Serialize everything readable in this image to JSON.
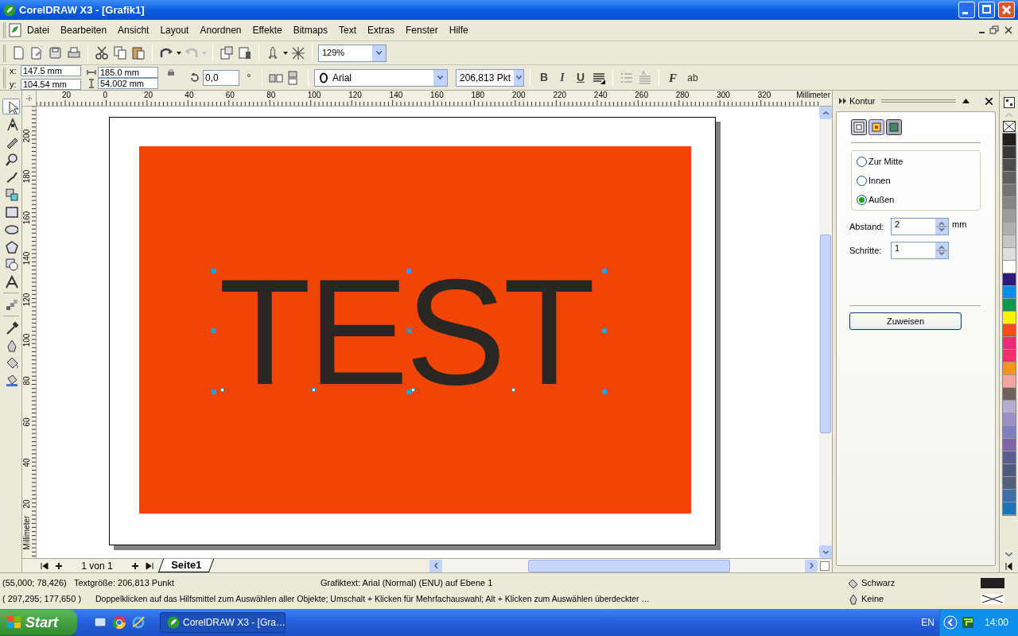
{
  "window": {
    "title": "CorelDRAW X3 - [Grafik1]"
  },
  "menu": [
    "Datei",
    "Bearbeiten",
    "Ansicht",
    "Layout",
    "Anordnen",
    "Effekte",
    "Bitmaps",
    "Text",
    "Extras",
    "Fenster",
    "Hilfe"
  ],
  "toolbar": {
    "zoom": "129%"
  },
  "property_bar": {
    "x_label": "x:",
    "x": "147.5 mm",
    "y_label": "y:",
    "y": "104.54 mm",
    "width": "185.0 mm",
    "height": "54.002 mm",
    "rotation": "0,0",
    "rotation_unit": "°",
    "font": "Arial",
    "font_size": "206,813 Pkt",
    "style_buttons": [
      "B",
      "I",
      "U"
    ],
    "text_buttons": [
      "F",
      "ab"
    ]
  },
  "h_ruler": {
    "labels": [
      "20",
      "0",
      "20",
      "40",
      "60",
      "80",
      "100",
      "120",
      "140",
      "160",
      "180",
      "200",
      "220",
      "240",
      "260",
      "280",
      "300",
      "320"
    ],
    "unit": "Millimeter"
  },
  "v_ruler": {
    "labels": [
      "200",
      "180",
      "160",
      "140",
      "120",
      "100",
      "80",
      "60",
      "40",
      "20"
    ],
    "unit": "Millimeter"
  },
  "canvas": {
    "text": "TEST"
  },
  "page_nav": {
    "position": "1 von 1",
    "tab": "Seite1"
  },
  "docker": {
    "title": "Kontur",
    "options": [
      {
        "label": "Zur Mitte",
        "selected": false
      },
      {
        "label": "Innen",
        "selected": false
      },
      {
        "label": "Außen",
        "selected": true
      }
    ],
    "fields": [
      {
        "label": "Abstand:",
        "value": "2",
        "unit": "mm"
      },
      {
        "label": "Schritte:",
        "value": "1"
      }
    ],
    "button": "Zuweisen"
  },
  "palette": [
    {
      "color": "#231f20"
    },
    {
      "color": "#3b3839"
    },
    {
      "color": "#4d4b4c"
    },
    {
      "color": "#615f5f"
    },
    {
      "color": "#747272"
    },
    {
      "color": "#878686"
    },
    {
      "color": "#9c9b9b"
    },
    {
      "color": "#b0afaf"
    },
    {
      "color": "#c7c6c6"
    },
    {
      "color": "#dedede"
    },
    {
      "color": "#ffffff"
    },
    {
      "color": "#2e1a7c"
    },
    {
      "color": "#0a8fe0"
    },
    {
      "color": "#10984a"
    },
    {
      "color": "#fff200"
    },
    {
      "color": "#f04e1b"
    },
    {
      "color": "#ec2c78"
    },
    {
      "color": "#e8336d"
    },
    {
      "color": "#f7941d"
    },
    {
      "color": "#f5a3a0"
    },
    {
      "color": "#6e625b"
    },
    {
      "color": "#b4aed4"
    },
    {
      "color": "#9b8fc6"
    },
    {
      "color": "#7e7fbf"
    },
    {
      "color": "#8066a8"
    },
    {
      "color": "#5c5f8e"
    },
    {
      "color": "#4f5a80"
    },
    {
      "color": "#51617f"
    },
    {
      "color": "#3e6fa8"
    },
    {
      "color": "#1b75bb"
    }
  ],
  "status_bar": {
    "cursor": "(55,000; 78,426)",
    "text_size": "Textgröße: 206,813 Punkt",
    "object_info": "Grafiktext: Arial (Normal) (ENU) auf Ebene 1",
    "position": "( 297,295; 177,650 )",
    "hint": "Doppelklicken auf das Hilfsmittel zum Auswählen aller Objekte; Umschalt + Klicken für Mehrfachauswahl; Alt + Klicken zum Auswählen überdeckter …",
    "fill": {
      "label": "Schwarz",
      "color": "#231f20"
    },
    "outline": {
      "label": "Keine"
    }
  },
  "taskbar": {
    "start": "Start",
    "tasks": [
      {
        "label": "CorelDRAW X3 - [Gra…",
        "selected": true
      }
    ],
    "language": "EN",
    "clock": "14:00"
  }
}
